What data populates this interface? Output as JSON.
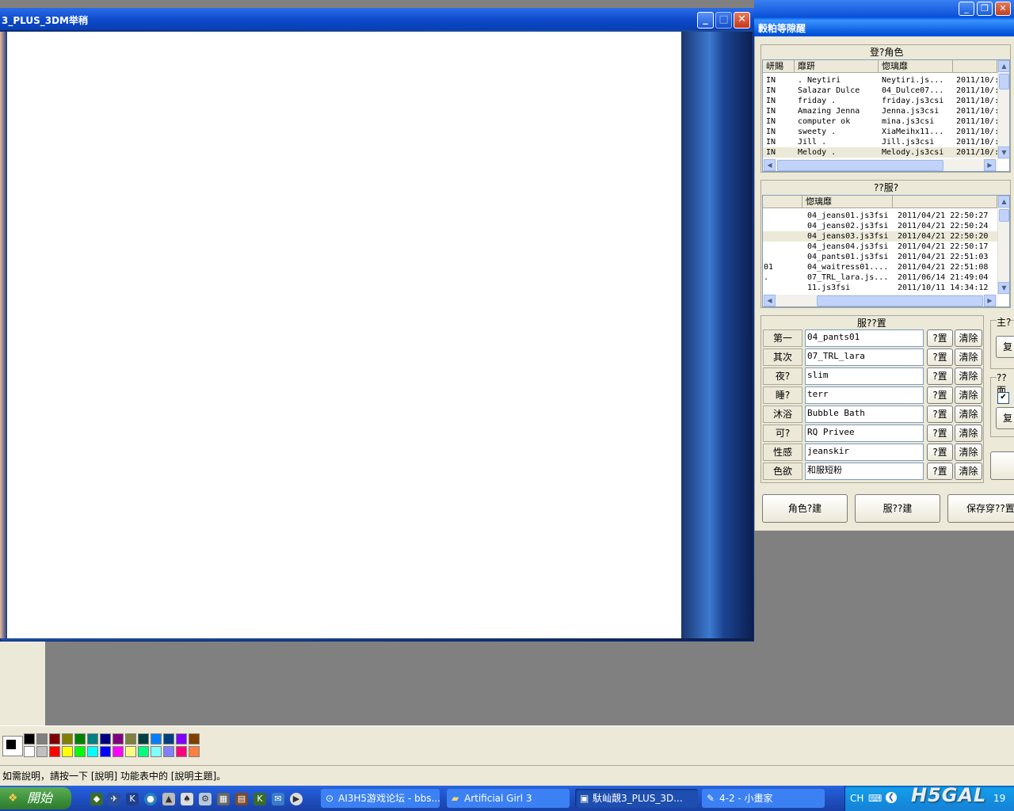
{
  "game_window": {
    "title": "3_PLUS_3DM举稍"
  },
  "tool_panel": {
    "title": "豰粕等隙醒",
    "char_group_title": "登?角色",
    "char_headers": [
      "岍賜",
      "靡趼",
      "惚璃靡",
      ""
    ],
    "char_rows": [
      [
        "IN",
        ". Neytiri",
        "Neytiri.js...",
        "2011/10/:"
      ],
      [
        "IN",
        "Salazar Dulce",
        "04_Dulce07...",
        "2011/10/:"
      ],
      [
        "IN",
        "friday .",
        "friday.js3csi",
        "2011/10/:"
      ],
      [
        "IN",
        "Amazing Jenna",
        "Jenna.js3csi",
        "2011/10/:"
      ],
      [
        "IN",
        "computer ok",
        "mina.js3csi",
        "2011/10/:"
      ],
      [
        "IN",
        "sweety .",
        "XiaMeihx11...",
        "2011/10/:"
      ],
      [
        "IN",
        "Jill .",
        "Jill.js3csi",
        "2011/10/:"
      ],
      [
        "IN",
        "Melody .",
        "Melody.js3csi",
        "2011/10/:"
      ]
    ],
    "cloth_group_title": "??服?",
    "cloth_headers": [
      "",
      "惚璃靡",
      ""
    ],
    "cloth_rows": [
      [
        "",
        "04_jeans01.js3fsi",
        "2011/04/21 22:50:27"
      ],
      [
        "",
        "04_jeans02.js3fsi",
        "2011/04/21 22:50:24"
      ],
      [
        "",
        "04_jeans03.js3fsi",
        "2011/04/21 22:50:20"
      ],
      [
        "",
        "04_jeans04.js3fsi",
        "2011/04/21 22:50:17"
      ],
      [
        "",
        "04_pants01.js3fsi",
        "2011/04/21 22:51:03"
      ],
      [
        "01",
        "04_waitress01....",
        "2011/04/21 22:51:08"
      ],
      [
        ".",
        "07_TRL_lara.js...",
        "2011/06/14 21:49:04"
      ],
      [
        "",
        "11.js3fsi",
        "2011/10/11 14:34:12"
      ]
    ],
    "outfit_group_title": "服??置",
    "slots": [
      {
        "label": "第一",
        "value": "04_pants01"
      },
      {
        "label": "其次",
        "value": "07_TRL_lara"
      },
      {
        "label": "夜?",
        "value": "slim"
      },
      {
        "label": "睡?",
        "value": "terr"
      },
      {
        "label": "沐浴",
        "value": "Bubble Bath"
      },
      {
        "label": "可?",
        "value": "RQ Privee"
      },
      {
        "label": "性感",
        "value": "jeanskir"
      },
      {
        "label": "色欲",
        "value": "和服短粉"
      }
    ],
    "set_label": "?置",
    "clear_label": "清除",
    "right_group1_title": "主?",
    "right_btn1": "复",
    "right_group2_title": "??面",
    "right_check": "✔",
    "right_btn2": "复",
    "bottom_buttons": [
      "角色?建",
      "服??建",
      "保存穿??置"
    ]
  },
  "paint": {
    "status_text": "如需說明，請按一下 [說明] 功能表中的 [說明主題]。",
    "palette_top": [
      "#000000",
      "#808080",
      "#800000",
      "#808000",
      "#008000",
      "#008080",
      "#000080",
      "#800080",
      "#808040",
      "#004040",
      "#0080ff",
      "#004080",
      "#8000ff",
      "#804000"
    ],
    "palette_bottom": [
      "#ffffff",
      "#c0c0c0",
      "#ff0000",
      "#ffff00",
      "#00ff00",
      "#00ffff",
      "#0000ff",
      "#ff00ff",
      "#ffff80",
      "#00ff80",
      "#80ffff",
      "#8080ff",
      "#ff0080",
      "#ff8040"
    ]
  },
  "taskbar": {
    "start_label": "開始",
    "tasks": [
      "AI3H5游戏论坛 - bbs...",
      "Artificial Girl 3",
      "馱屾覿3_PLUS_3D...",
      "4-2 - 小畫家"
    ],
    "lang": "CH",
    "clock": "19",
    "watermark": "H5GAL"
  }
}
